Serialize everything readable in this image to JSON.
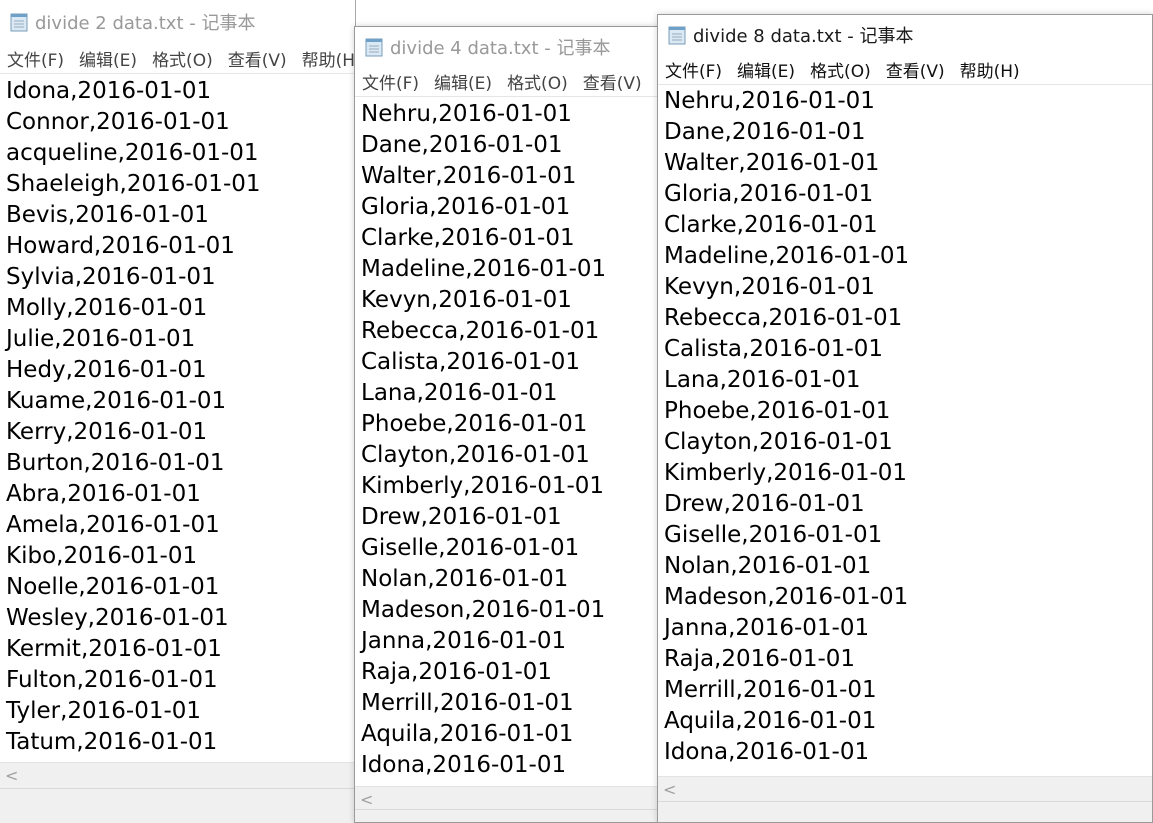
{
  "windows": [
    {
      "title": "divide 2 data.txt - 记事本",
      "menu": [
        "文件(F)",
        "编辑(E)",
        "格式(O)",
        "查看(V)",
        "帮助(H)"
      ],
      "lines": [
        "Idona,2016-01-01",
        "Connor,2016-01-01",
        "acqueline,2016-01-01",
        "Shaeleigh,2016-01-01",
        "Bevis,2016-01-01",
        "Howard,2016-01-01",
        "Sylvia,2016-01-01",
        "Molly,2016-01-01",
        "Julie,2016-01-01",
        "Hedy,2016-01-01",
        "Kuame,2016-01-01",
        "Kerry,2016-01-01",
        "Burton,2016-01-01",
        "Abra,2016-01-01",
        "Amela,2016-01-01",
        "Kibo,2016-01-01",
        "Noelle,2016-01-01",
        "Wesley,2016-01-01",
        "Kermit,2016-01-01",
        "Fulton,2016-01-01",
        "Tyler,2016-01-01",
        "Tatum,2016-01-01"
      ]
    },
    {
      "title": "divide 4 data.txt - 记事本",
      "menu": [
        "文件(F)",
        "编辑(E)",
        "格式(O)",
        "查看(V)"
      ],
      "lines": [
        "Nehru,2016-01-01",
        "Dane,2016-01-01",
        "Walter,2016-01-01",
        "Gloria,2016-01-01",
        "Clarke,2016-01-01",
        "Madeline,2016-01-01",
        "Kevyn,2016-01-01",
        "Rebecca,2016-01-01",
        "Calista,2016-01-01",
        "Lana,2016-01-01",
        "Phoebe,2016-01-01",
        "Clayton,2016-01-01",
        "Kimberly,2016-01-01",
        "Drew,2016-01-01",
        "Giselle,2016-01-01",
        "Nolan,2016-01-01",
        "Madeson,2016-01-01",
        "Janna,2016-01-01",
        "Raja,2016-01-01",
        "Merrill,2016-01-01",
        "Aquila,2016-01-01",
        "Idona,2016-01-01"
      ]
    },
    {
      "title": "divide 8 data.txt - 记事本",
      "menu": [
        "文件(F)",
        "编辑(E)",
        "格式(O)",
        "查看(V)",
        "帮助(H)"
      ],
      "lines": [
        "Nehru,2016-01-01",
        "Dane,2016-01-01",
        "Walter,2016-01-01",
        "Gloria,2016-01-01",
        "Clarke,2016-01-01",
        "Madeline,2016-01-01",
        "Kevyn,2016-01-01",
        "Rebecca,2016-01-01",
        "Calista,2016-01-01",
        "Lana,2016-01-01",
        "Phoebe,2016-01-01",
        "Clayton,2016-01-01",
        "Kimberly,2016-01-01",
        "Drew,2016-01-01",
        "Giselle,2016-01-01",
        "Nolan,2016-01-01",
        "Madeson,2016-01-01",
        "Janna,2016-01-01",
        "Raja,2016-01-01",
        "Merrill,2016-01-01",
        "Aquila,2016-01-01",
        "Idona,2016-01-01"
      ]
    }
  ],
  "scroll_left_glyph": "<",
  "icons": {
    "app": "notepad-icon",
    "scroll_left": "chevron-left-icon"
  }
}
